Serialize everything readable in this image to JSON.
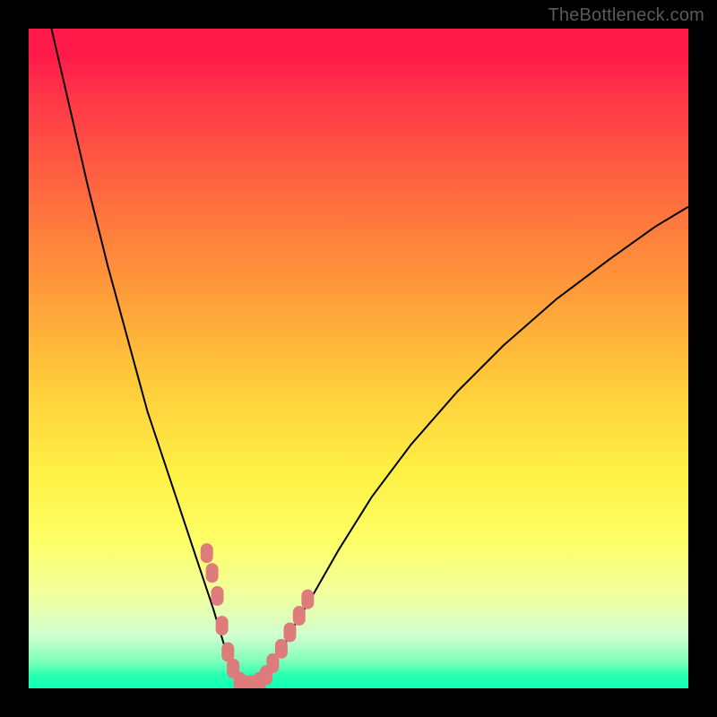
{
  "watermark": "TheBottleneck.com",
  "colors": {
    "frame": "#000000",
    "curve_stroke": "#000000",
    "marker_fill": "#de7b7b",
    "gradient_stops": [
      "#ff1a49",
      "#ff3548",
      "#ff6a3f",
      "#ff9c3a",
      "#ffcf3b",
      "#fff246",
      "#fdff67",
      "#f0ffa0",
      "#d0ffcf",
      "#7cffb8",
      "#2bffb0",
      "#0affb3"
    ]
  },
  "chart_data": {
    "type": "line",
    "title": "",
    "xlabel": "",
    "ylabel": "",
    "xlim": [
      0,
      100
    ],
    "ylim": [
      0,
      100
    ],
    "grid": false,
    "legend": false,
    "x": [
      0,
      3,
      6,
      9,
      12,
      15,
      18,
      21,
      24,
      26,
      28,
      29.5,
      30.5,
      31.3,
      32,
      33,
      34,
      35,
      36.3,
      38,
      40,
      43,
      47,
      52,
      58,
      65,
      72,
      80,
      88,
      95,
      100
    ],
    "y": [
      115,
      102,
      89,
      76,
      64,
      53,
      42,
      33,
      24,
      18,
      12,
      7,
      4,
      2,
      1,
      0.5,
      0.5,
      1,
      2.5,
      5,
      9,
      14,
      21,
      29,
      37,
      45,
      52,
      59,
      65,
      70,
      73
    ],
    "markers": {
      "x": [
        27.0,
        27.8,
        28.6,
        29.3,
        30.2,
        31.0,
        32.0,
        33.0,
        34.0,
        35.0,
        36.0,
        37.0,
        38.3,
        39.6,
        41.0,
        42.3
      ],
      "y": [
        20.5,
        17.5,
        14.0,
        9.5,
        5.5,
        3.0,
        1.0,
        0.5,
        0.5,
        1.0,
        2.0,
        3.8,
        6.0,
        8.5,
        11.0,
        13.5
      ]
    }
  }
}
